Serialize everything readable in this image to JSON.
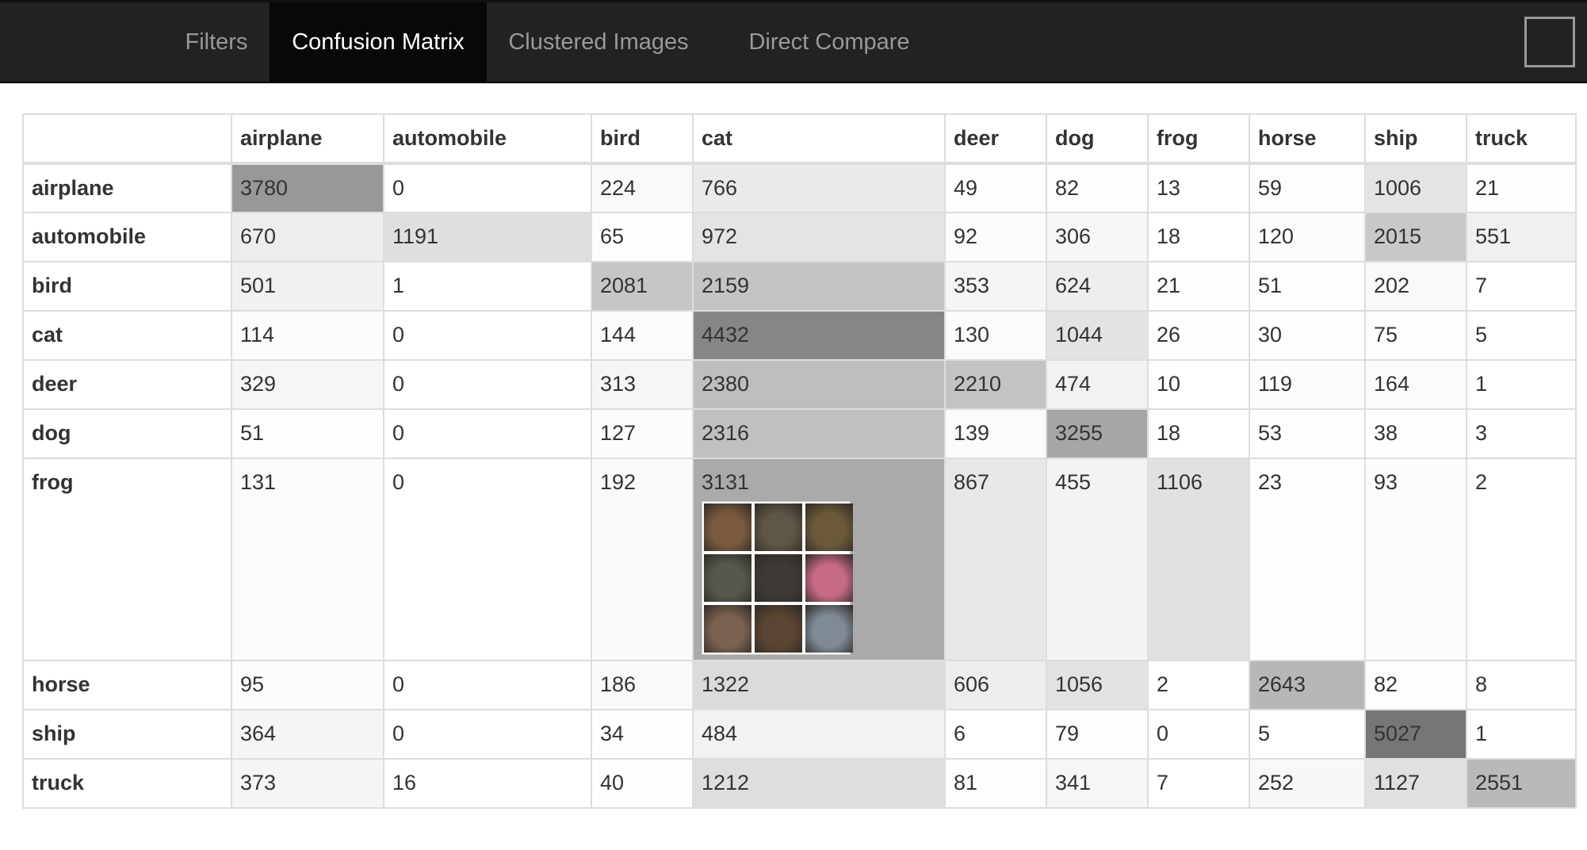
{
  "nav": {
    "tabs": [
      {
        "label": "Filters",
        "active": false
      },
      {
        "label": "Confusion Matrix",
        "active": true
      },
      {
        "label": "Clustered Images",
        "active": false
      },
      {
        "label": "Direct Compare",
        "active": false
      }
    ]
  },
  "matrix": {
    "corner": "",
    "columns": [
      "airplane",
      "automobile",
      "bird",
      "cat",
      "deer",
      "dog",
      "frog",
      "horse",
      "ship",
      "truck"
    ],
    "rows": [
      {
        "label": "airplane",
        "values": [
          3780,
          0,
          224,
          766,
          49,
          82,
          13,
          59,
          1006,
          21
        ]
      },
      {
        "label": "automobile",
        "values": [
          670,
          1191,
          65,
          972,
          92,
          306,
          18,
          120,
          2015,
          551
        ]
      },
      {
        "label": "bird",
        "values": [
          501,
          1,
          2081,
          2159,
          353,
          624,
          21,
          51,
          202,
          7
        ]
      },
      {
        "label": "cat",
        "values": [
          114,
          0,
          144,
          4432,
          130,
          1044,
          26,
          30,
          75,
          5
        ]
      },
      {
        "label": "deer",
        "values": [
          329,
          0,
          313,
          2380,
          2210,
          474,
          10,
          119,
          164,
          1
        ]
      },
      {
        "label": "dog",
        "values": [
          51,
          0,
          127,
          2316,
          139,
          3255,
          18,
          53,
          38,
          3
        ]
      },
      {
        "label": "frog",
        "values": [
          131,
          0,
          192,
          3131,
          867,
          455,
          1106,
          23,
          93,
          2
        ]
      },
      {
        "label": "horse",
        "values": [
          95,
          0,
          186,
          1322,
          606,
          1056,
          2,
          2643,
          82,
          8
        ]
      },
      {
        "label": "ship",
        "values": [
          364,
          0,
          34,
          484,
          6,
          79,
          0,
          5,
          5027,
          1
        ]
      },
      {
        "label": "truck",
        "values": [
          373,
          16,
          40,
          1212,
          81,
          341,
          7,
          252,
          1127,
          2551
        ]
      }
    ],
    "shade_max": 5500,
    "expanded_cell": {
      "row": "frog",
      "column": "cat",
      "thumbnail_colors": [
        "#7a5a3e",
        "#5e5646",
        "#6b5a3a",
        "#55594d",
        "#3d3a36",
        "#c76a86",
        "#7a6150",
        "#5a4432",
        "#7f8a95"
      ]
    }
  }
}
